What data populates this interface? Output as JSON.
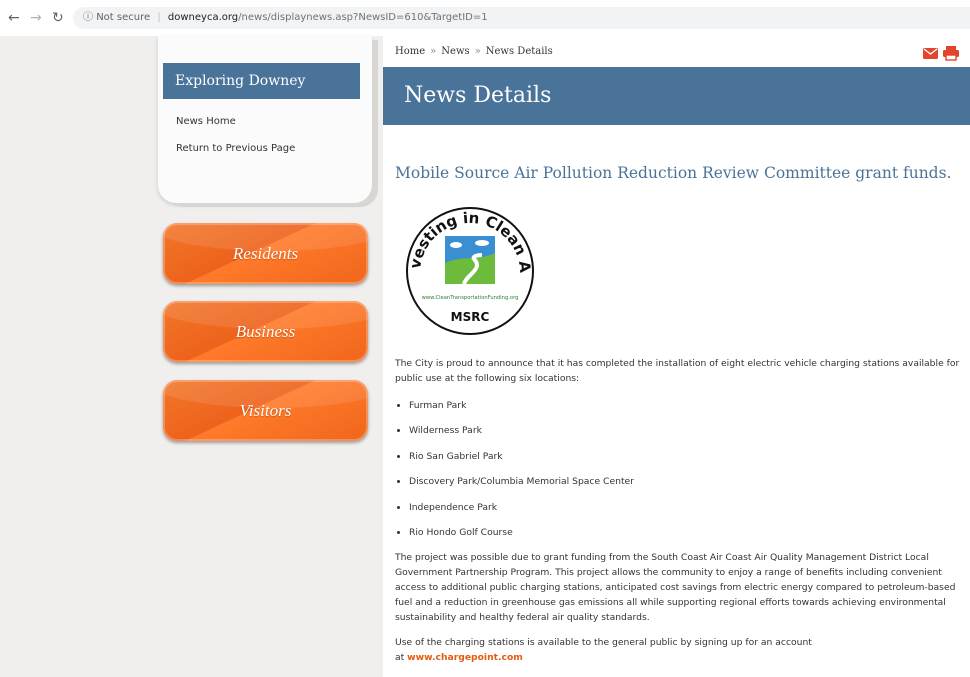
{
  "browser": {
    "security": "Not secure",
    "url_host": "downeyca.org",
    "url_path": "/news/displaynews.asp?NewsID=610&TargetID=1"
  },
  "sidebar": {
    "title": "Exploring Downey",
    "links": [
      "News Home",
      "Return to Previous Page"
    ],
    "buttons": [
      "Residents",
      "Business",
      "Visitors"
    ]
  },
  "breadcrumb": [
    "Home",
    "News",
    "News Details"
  ],
  "header": {
    "title": "News Details"
  },
  "article": {
    "title": "Mobile Source Air Pollution Reduction Review Committee grant funds.",
    "logo": {
      "top_text": "Investing in Clean Air",
      "url_text": "www.CleanTransportationFunding.org",
      "bottom_text": "MSRC"
    },
    "intro": "The City is proud to announce that it has completed the installation of eight electric vehicle charging stations available for public use at the following six locations:",
    "locations": [
      "Furman Park",
      "Wilderness Park",
      "Rio San Gabriel Park",
      "Discovery Park/Columbia Memorial Space Center",
      "Independence Park",
      "Rio Hondo Golf Course"
    ],
    "para2": "The project was possible due to grant funding from the South Coast Air Coast Air Quality Management District Local Government Partnership Program. This project allows the community to enjoy a range of benefits including convenient access to additional public charging stations, anticipated cost savings from electric energy compared to petroleum-based fuel and a reduction in greenhouse gas emissions all while supporting regional efforts towards achieving environmental sustainability and healthy federal air quality standards.",
    "para3_line1": "Use of the charging stations is available to the general public by signing up for an account",
    "para3_at": "at ",
    "link_text": "www.chargepoint.com"
  },
  "colors": {
    "accent_blue": "#4a7399",
    "accent_orange": "#ee621c",
    "tool_icon": "#e2452b"
  },
  "icons": [
    "back-arrow-icon",
    "forward-arrow-icon",
    "reload-icon",
    "info-icon",
    "email-icon",
    "print-icon"
  ]
}
